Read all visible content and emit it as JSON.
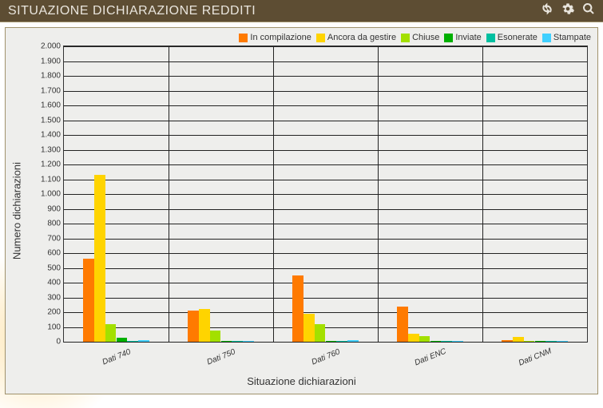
{
  "header": {
    "title": "SITUAZIONE DICHIARAZIONE REDDITI",
    "icons": {
      "refresh": "refresh-icon",
      "settings": "gear-icon",
      "search": "search-icon"
    }
  },
  "chart_data": {
    "type": "bar",
    "title": "",
    "xlabel": "Situazione dichiarazioni",
    "ylabel": "Numero dichiarazioni",
    "ylim": [
      0,
      2000
    ],
    "ystep": 100,
    "categories": [
      "Dati 740",
      "Dati 750",
      "Dati 760",
      "Dati ENC",
      "Dati CNM"
    ],
    "series": [
      {
        "name": "In compilazione",
        "color": "#ff7a00",
        "values": [
          560,
          210,
          450,
          240,
          10
        ]
      },
      {
        "name": "Ancora da gestire",
        "color": "#ffd400",
        "values": [
          1130,
          220,
          190,
          55,
          35
        ]
      },
      {
        "name": "Chiuse",
        "color": "#a3e000",
        "values": [
          120,
          75,
          120,
          40,
          5
        ]
      },
      {
        "name": "Inviate",
        "color": "#00b000",
        "values": [
          25,
          8,
          5,
          5,
          3
        ]
      },
      {
        "name": "Esonerate",
        "color": "#00c0a0",
        "values": [
          5,
          5,
          5,
          8,
          3
        ]
      },
      {
        "name": "Stampate",
        "color": "#40d0ff",
        "values": [
          10,
          8,
          10,
          5,
          3
        ]
      }
    ]
  },
  "number_locale": "it-IT"
}
